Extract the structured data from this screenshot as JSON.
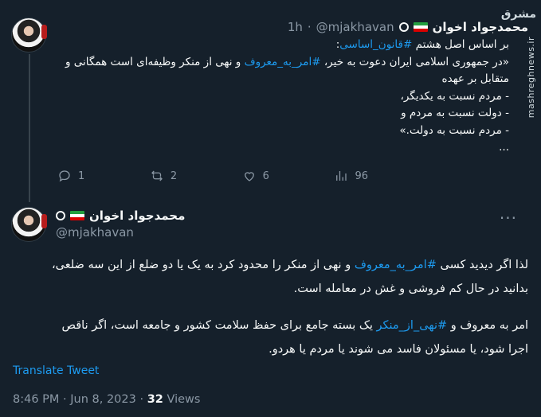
{
  "watermark": {
    "logo_text": "مشرق",
    "url": "mashreghnews.ir"
  },
  "tweet1": {
    "author_name": "محمدجواد اخوان",
    "handle": "@mjakhavan",
    "separator": "·",
    "time": "1h",
    "lines": [
      [
        "بر اساس اصل هشتم ",
        {
          "hash": "#قانون_اساسی"
        },
        ":"
      ],
      [
        "«در جمهوری اسلامی ایران دعوت به خیر، ",
        {
          "hash": "#امر_به_معروف"
        },
        " و نهی از منکر وظیفه‌ای است همگانی و"
      ],
      [
        "متقابل بر عهده"
      ],
      [
        "- مردم نسبت به یکدیگر،"
      ],
      [
        "- دولت نسبت به مردم و"
      ],
      [
        "- مردم نسبت به دولت.»"
      ],
      [
        "..."
      ]
    ],
    "actions": {
      "replies": "1",
      "retweets": "2",
      "likes": "6",
      "views": "96"
    }
  },
  "tweet2": {
    "author_name": "محمدجواد اخوان",
    "handle": "@mjakhavan",
    "para1": [
      "لذا اگر دیدید کسی ",
      {
        "hash": "#امر_به_معروف"
      },
      " و نهی از منکر را محدود کرد به یک یا دو ضلع از این سه ضلعی،",
      "\nبدانید در حال کم فروشی و غش در معامله است."
    ],
    "para2": [
      "امر به معروف و ",
      {
        "hash": "#نهی_از_منکر"
      },
      " یک بسته جامع برای حفظ سلامت کشور و جامعه است، اگر ناقص",
      "\nاجرا شود، یا مسئولان فاسد می شوند یا مردم یا هردو."
    ],
    "translate_label": "Translate Tweet",
    "timestamp": "8:46 PM · Jun 8, 2023 · ",
    "views_count": "32",
    "views_label": " Views"
  }
}
